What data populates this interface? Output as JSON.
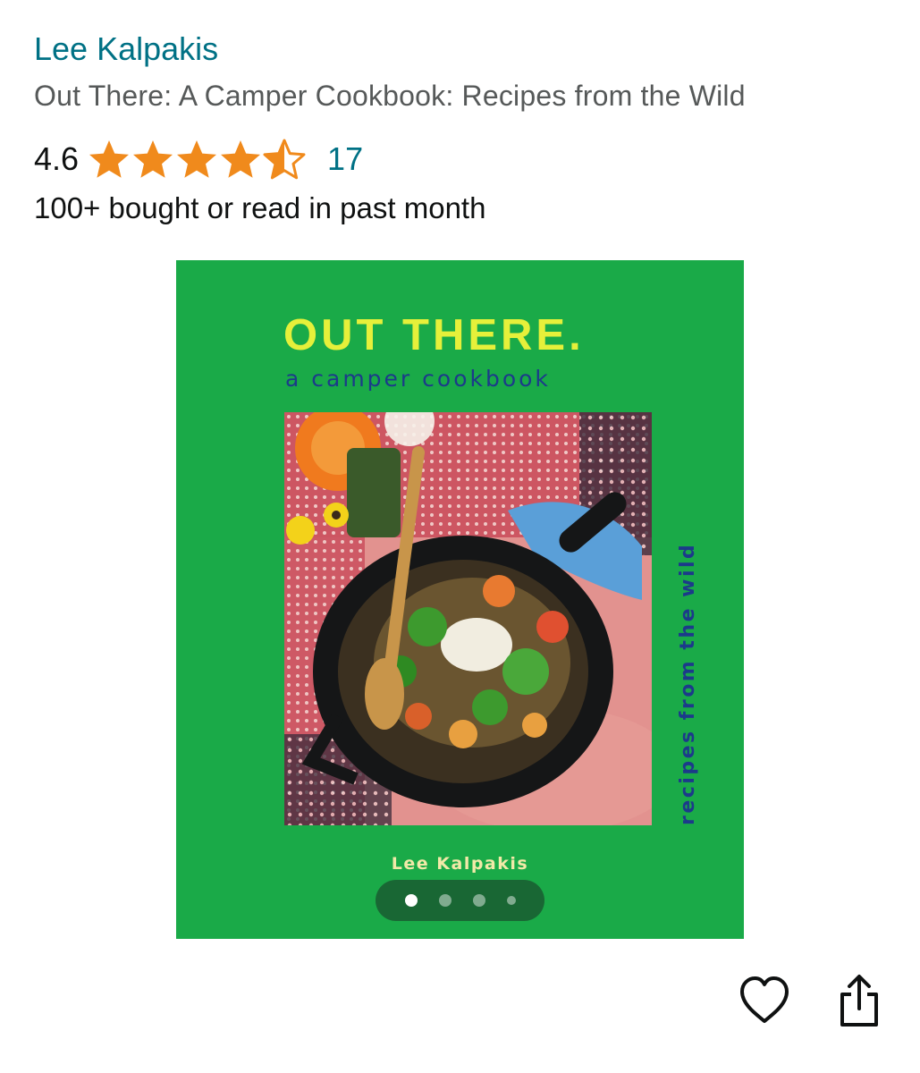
{
  "product": {
    "author": "Lee Kalpakis",
    "title": "Out There: A Camper Cookbook: Recipes from the Wild",
    "rating_value": "4.6",
    "rating_fraction": 0.92,
    "rating_count": "17",
    "bought_text": "100+ bought or read in past month"
  },
  "cover": {
    "title": "OUT THERE.",
    "subtitle": "a camper cookbook",
    "vertical_text": "recipes from the wild",
    "author": "Lee Kalpakis",
    "background_color": "#1aaa48"
  },
  "carousel": {
    "total_images": 4,
    "current_index": 1
  },
  "actions": {
    "wishlist_icon": "heart-icon",
    "share_icon": "share-icon"
  },
  "colors": {
    "link": "#007185",
    "star": "#f08a1c",
    "secondary_text": "#565959"
  }
}
